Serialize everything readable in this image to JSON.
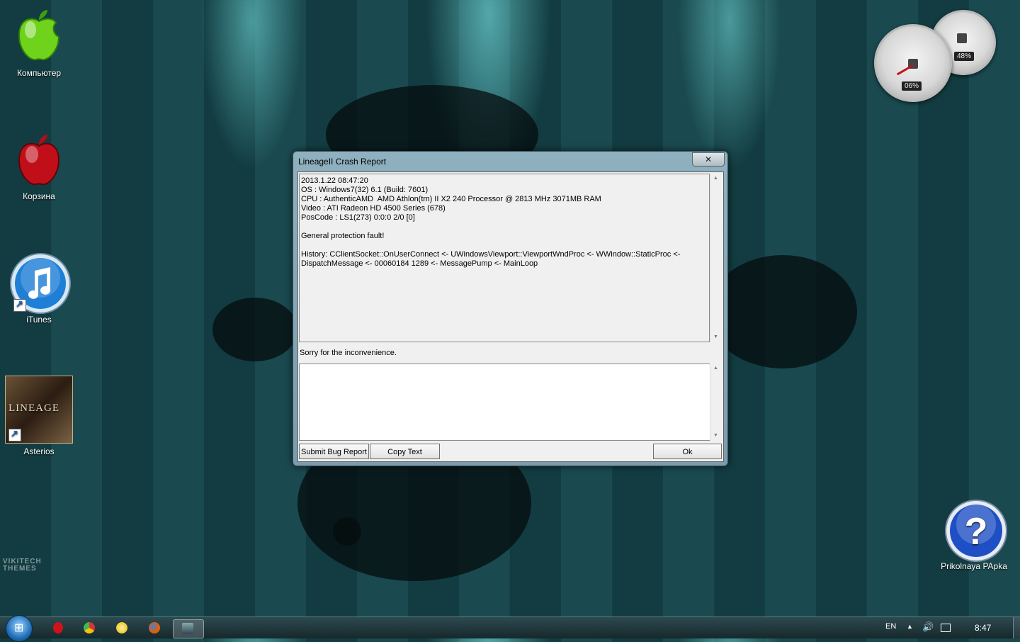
{
  "desktop": {
    "icons": [
      {
        "label": "Компьютер"
      },
      {
        "label": "Корзина"
      },
      {
        "label": "iTunes"
      },
      {
        "label": "Asterios"
      },
      {
        "label": "Prikolnaya PApka"
      }
    ],
    "lineage_logo_text": "LINEAGE",
    "watermark_text": "VIKITECH THEMES"
  },
  "gadget": {
    "cpu_percent": "06%",
    "memory_percent": "48%"
  },
  "crash_window": {
    "title": "LineageII Crash Report",
    "close_label": "✕",
    "log_text": "2013.1.22 08:47:20\nOS : Windows7(32) 6.1 (Build: 7601)\nCPU : AuthenticAMD  AMD Athlon(tm) II X2 240 Processor @ 2813 MHz 3071MB RAM\nVideo : ATI Radeon HD 4500 Series (678)\nPosCode : LS1(273) 0:0:0 2/0 [0]\n\nGeneral protection fault!\n\nHistory: CClientSocket::OnUserConnect <- UWindowsViewport::ViewportWndProc <- WWindow::StaticProc <-\nDispatchMessage <- 00060184 1289 <- MessagePump <- MainLoop",
    "sorry_text": "Sorry for the inconvenience.",
    "input_value": "",
    "buttons": {
      "submit": "Submit Bug Report",
      "copy": "Copy Text",
      "ok": "Ok"
    }
  },
  "taskbar": {
    "language": "EN",
    "clock": "8:47"
  }
}
